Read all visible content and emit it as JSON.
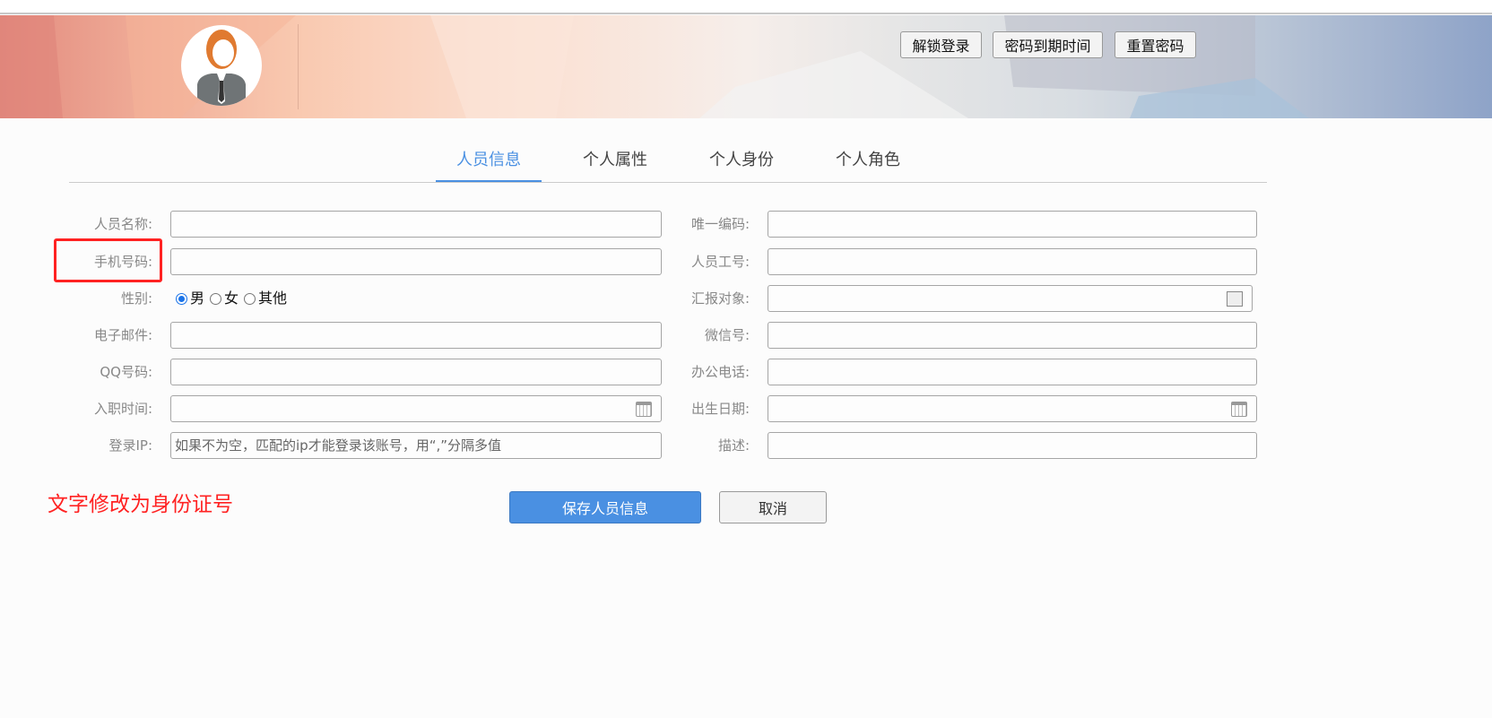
{
  "header": {
    "buttons": [
      "解锁登录",
      "密码到期时间",
      "重置密码"
    ]
  },
  "tabs": [
    "人员信息",
    "个人属性",
    "个人身份",
    "个人角色"
  ],
  "form": {
    "left": [
      {
        "label": "人员名称:",
        "value": ""
      },
      {
        "label": "手机号码:",
        "value": ""
      },
      {
        "label": "性别:",
        "options": [
          "男",
          "女",
          "其他"
        ],
        "selected": "男"
      },
      {
        "label": "电子邮件:",
        "value": ""
      },
      {
        "label": "QQ号码:",
        "value": ""
      },
      {
        "label": "入职时间:",
        "value": ""
      },
      {
        "label": "登录IP:",
        "placeholder": "如果不为空，匹配的ip才能登录该账号，用“,”分隔多值"
      }
    ],
    "right": [
      {
        "label": "唯一编码:",
        "value": ""
      },
      {
        "label": "人员工号:",
        "value": ""
      },
      {
        "label": "汇报对象:",
        "value": ""
      },
      {
        "label": "微信号:",
        "value": ""
      },
      {
        "label": "办公电话:",
        "value": ""
      },
      {
        "label": "出生日期:",
        "value": ""
      },
      {
        "label": "描述:",
        "value": ""
      }
    ]
  },
  "annotation": "文字修改为身份证号",
  "actions": {
    "save": "保存人员信息",
    "cancel": "取消"
  },
  "colors": {
    "accent": "#4a90e2",
    "annotation": "#ff2222"
  }
}
